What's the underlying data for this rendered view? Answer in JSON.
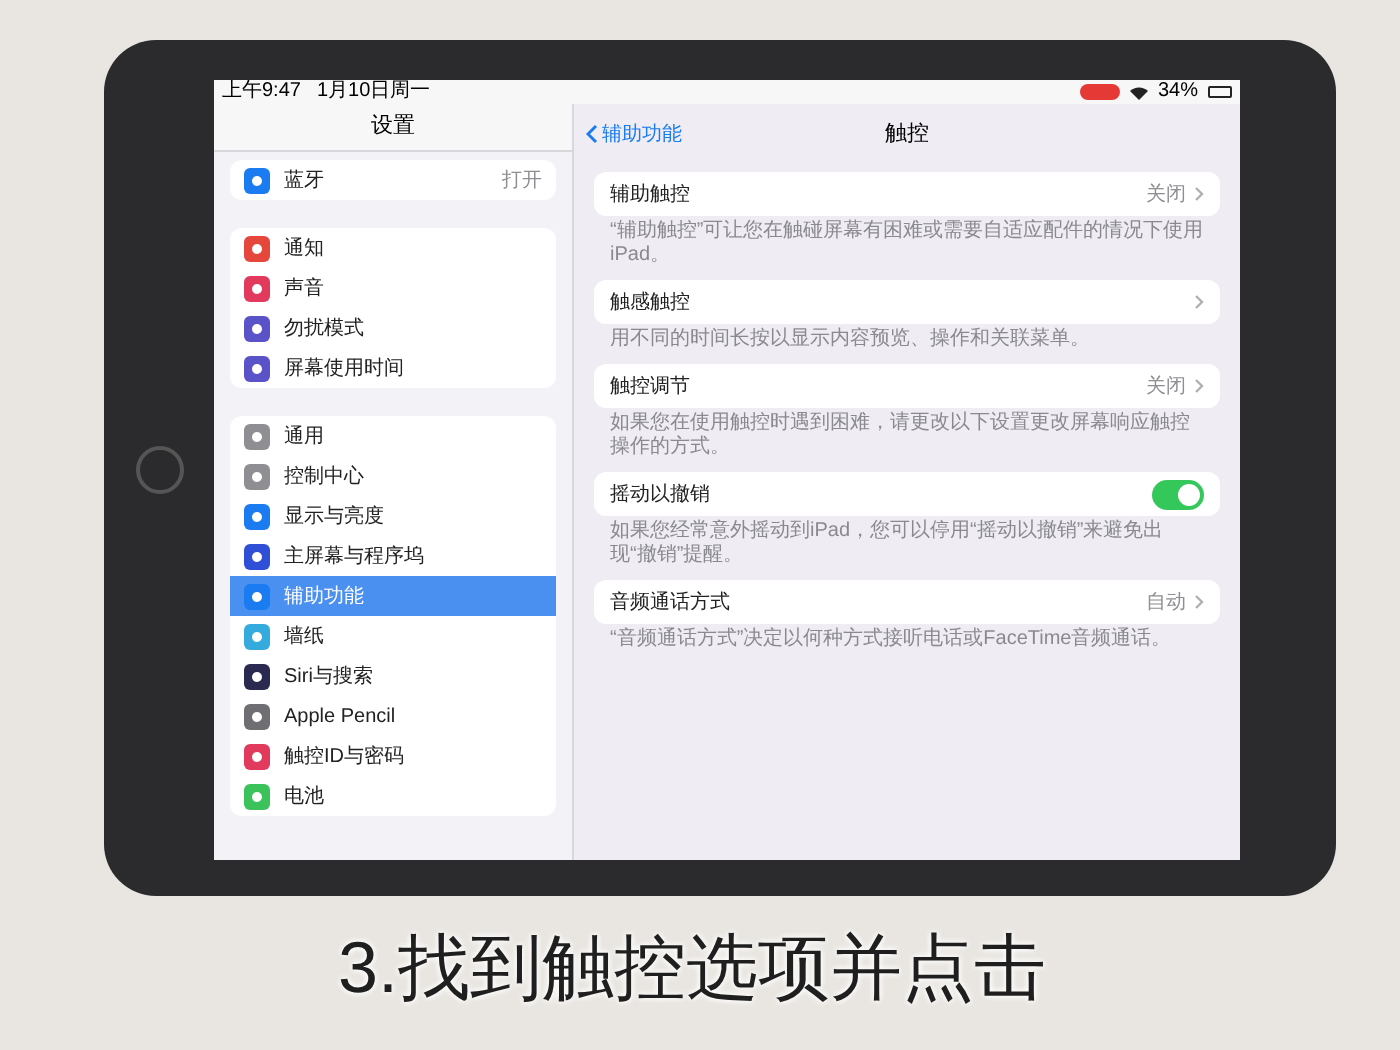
{
  "status_bar": {
    "time": "上午9:47",
    "date": "1月10日周一",
    "recording": true,
    "battery": "34%"
  },
  "sidebar": {
    "title": "设置",
    "groups": [
      [
        {
          "label": "蓝牙",
          "value": "打开",
          "selected": false,
          "color": "#1a7cf0"
        }
      ],
      [
        {
          "label": "通知",
          "selected": false,
          "color": "#e5473d"
        },
        {
          "label": "声音",
          "selected": false,
          "color": "#e23a5c"
        },
        {
          "label": "勿扰模式",
          "selected": false,
          "color": "#5a52c8"
        },
        {
          "label": "屏幕使用时间",
          "selected": false,
          "color": "#5a52c8"
        }
      ],
      [
        {
          "label": "通用",
          "selected": false,
          "color": "#8e8e93"
        },
        {
          "label": "控制中心",
          "selected": false,
          "color": "#8e8e93"
        },
        {
          "label": "显示与亮度",
          "selected": false,
          "color": "#1a7cf0"
        },
        {
          "label": "主屏幕与程序坞",
          "selected": false,
          "color": "#2e4fd6"
        },
        {
          "label": "辅助功能",
          "selected": true,
          "color": "#1a7cf0"
        },
        {
          "label": "墙纸",
          "selected": false,
          "color": "#35aadc"
        },
        {
          "label": "Siri与搜索",
          "selected": false,
          "color": "#2a2a50"
        },
        {
          "label": "Apple Pencil",
          "selected": false,
          "color": "#6e6e73"
        },
        {
          "label": "触控ID与密码",
          "selected": false,
          "color": "#e23a5c"
        },
        {
          "label": "电池",
          "selected": false,
          "color": "#3cc25a"
        }
      ]
    ]
  },
  "detail": {
    "back_label": "辅助功能",
    "title": "触控",
    "rows": [
      {
        "kind": "link",
        "label": "辅助触控",
        "value": "关闭",
        "footnote": "“辅助触控”可让您在触碰屏幕有困难或需要自适应配件的情况下使用 iPad。"
      },
      {
        "kind": "link",
        "label": "触感触控",
        "footnote": "用不同的时间长按以显示内容预览、操作和关联菜单。"
      },
      {
        "kind": "link",
        "label": "触控调节",
        "value": "关闭",
        "footnote": "如果您在使用触控时遇到困难，请更改以下设置更改屏幕响应触控操作的方式。"
      },
      {
        "kind": "toggle",
        "label": "摇动以撤销",
        "on": true,
        "footnote": "如果您经常意外摇动到iPad，您可以停用“摇动以撤销”来避免出现“撤销”提醒。"
      },
      {
        "kind": "link",
        "label": "音频通话方式",
        "value": "自动",
        "footnote": "“音频通话方式”决定以何种方式接听电话或FaceTime音频通话。"
      }
    ]
  },
  "caption": "3.找到触控选项并点击"
}
